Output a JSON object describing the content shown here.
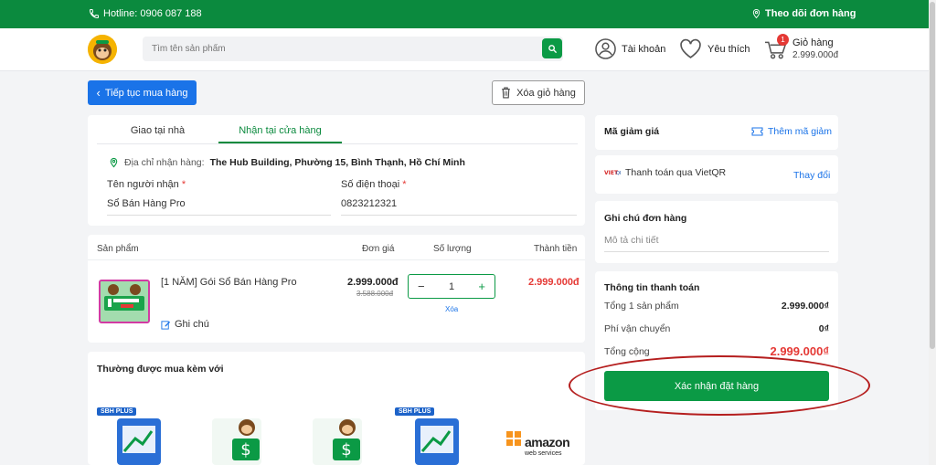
{
  "topbar": {
    "hotline": "Hotline: 0906 087 188",
    "track_orders": "Theo dõi đơn hàng"
  },
  "header": {
    "search_placeholder": "Tìm tên sản phẩm",
    "account": "Tài khoản",
    "wishlist": "Yêu thích",
    "cart_label": "Giỏ hàng",
    "cart_total": "2.999.000đ",
    "cart_count": "1"
  },
  "actions": {
    "continue_shopping": "Tiếp tục mua hàng",
    "clear_cart": "Xóa giỏ hàng"
  },
  "delivery": {
    "tabs": [
      "Giao tại nhà",
      "Nhận tại cửa hàng"
    ],
    "active_tab": 1,
    "address_label": "Địa chỉ nhận hàng:",
    "address_value": "The Hub Building, Phường 15, Bình Thạnh, Hồ Chí Minh",
    "recipient_label": "Tên người nhận",
    "recipient_value": "Sổ Bán Hàng Pro",
    "phone_label": "Số điện thoại",
    "phone_value": "0823212321",
    "required_mark": "*"
  },
  "cart": {
    "headers": {
      "product": "Sản phẩm",
      "unit_price": "Đơn giá",
      "quantity": "Số lượng",
      "total": "Thành tiền"
    },
    "items": [
      {
        "name": "[1 NĂM] Gói Sổ Bán Hàng Pro",
        "price": "2.999.000đ",
        "old_price": "3.588.000đ",
        "quantity": "1",
        "total": "2.999.000đ",
        "note": "Ghi chú",
        "remove": "Xóa",
        "minus": "−",
        "plus": "+"
      }
    ]
  },
  "related": {
    "title": "Thường được mua kèm với",
    "tag": "SBH PLUS",
    "amazon_text": "amazon",
    "amazon_sub": "web services"
  },
  "sidebar": {
    "coupon_label": "Mã giảm giá",
    "coupon_add": "Thêm mã giảm",
    "payment_method": "Thanh toán qua VietQR",
    "payment_change": "Thay đổi",
    "note_title": "Ghi chú đơn hàng",
    "note_placeholder": "Mô tả chi tiết",
    "summary_title": "Thông tin thanh toán",
    "subtotal_label": "Tổng 1 sản phẩm",
    "subtotal_value": "2.999.000₫",
    "shipping_label": "Phí vận chuyển",
    "shipping_value": "0₫",
    "total_label": "Tổng cộng",
    "total_value": "2.999.000₫",
    "confirm": "Xác nhận đặt hàng"
  },
  "colors": {
    "brand_green": "#0b8a3e",
    "primary_blue": "#1a73e8",
    "price_red": "#e53935",
    "annotation_red": "#b51e1e"
  }
}
